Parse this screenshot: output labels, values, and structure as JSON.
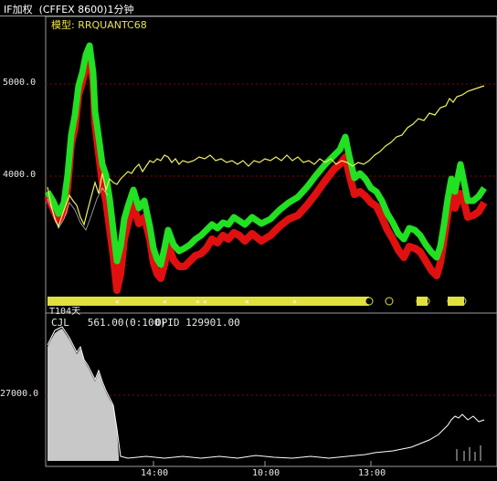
{
  "window": {
    "title": "IF加权  (CFFEX 8600)1分钟"
  },
  "main_panel": {
    "model_label": "模型: RRQUANTC68",
    "y_ticks": [
      "5000.0",
      "4000.0"
    ],
    "band_label": "T104天"
  },
  "volume_panel": {
    "indicator_label": "CJL   561.00(0:100)",
    "opid_label": "OPID 129901.00",
    "y_ticks": [
      "27000.0"
    ]
  },
  "x_axis": {
    "ticks": [
      "14:00",
      "10:00",
      "13:00"
    ]
  },
  "colors": {
    "background": "#000000",
    "grid": "#8a0000",
    "price_line": "#f0f060",
    "bull_candle": "#22e022",
    "bear_candle": "#e01010",
    "band": "#e0e040",
    "volume": "#c8c8c8"
  }
}
